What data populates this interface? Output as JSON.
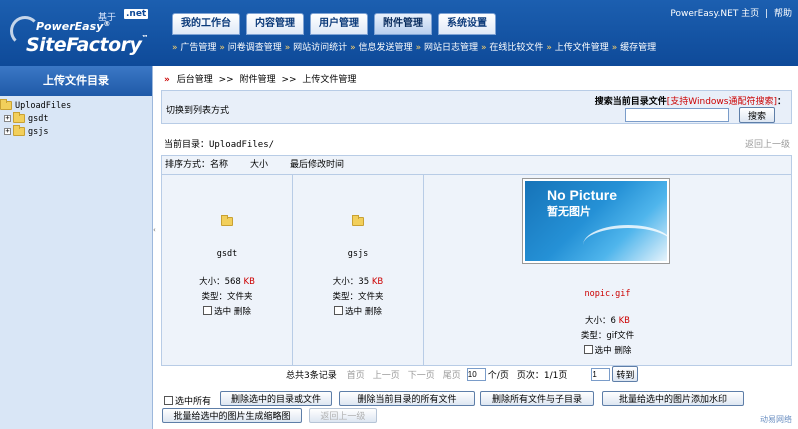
{
  "header": {
    "logo": {
      "based_on": "基于",
      "net": ".net",
      "line1": "PowerEasy",
      "line1_mark": "®",
      "line2": "SiteFactory",
      "line2_mark": "™"
    },
    "tabs": [
      {
        "label": "我的工作台",
        "active": false
      },
      {
        "label": "内容管理",
        "active": false
      },
      {
        "label": "用户管理",
        "active": false
      },
      {
        "label": "附件管理",
        "active": true
      },
      {
        "label": "系统设置",
        "active": false
      }
    ],
    "top_links": {
      "home": "PowerEasy.NET 主页",
      "sep": "|",
      "help": "帮助"
    },
    "subnav": [
      "广告管理",
      "问卷调查管理",
      "网站访问统计",
      "信息发送管理",
      "网站日志管理",
      "在线比较文件",
      "上传文件管理",
      "缓存管理"
    ]
  },
  "sidebar": {
    "title": "上传文件目录",
    "root": "UploadFiles",
    "children": [
      {
        "expander": "+",
        "label": "gsdt"
      },
      {
        "expander": "+",
        "label": "gsjs"
      }
    ],
    "collapse_glyph": "‹"
  },
  "main": {
    "breadcrumb": {
      "marker": "»",
      "items": [
        "后台管理",
        "附件管理",
        "上传文件管理"
      ],
      "sep": ">>"
    },
    "search": {
      "switch_view": "切换到列表方式",
      "label": "搜索当前目录文件",
      "hint": "[支持Windows通配符搜索]",
      "colon": "：",
      "value": "",
      "button": "搜索"
    },
    "current_dir": {
      "label": "当前目录：",
      "path": "UploadFiles/",
      "up": "返回上一级"
    },
    "sort": {
      "label": "排序方式：",
      "options": [
        "名称",
        "大小",
        "最后修改时间"
      ]
    },
    "files": [
      {
        "name": "gsdt",
        "size_label": "大小：",
        "size": "568",
        "unit": "KB",
        "type_label": "类型：",
        "type": "文件夹",
        "select": "选中",
        "delete": "删除"
      },
      {
        "name": "gsjs",
        "size_label": "大小：",
        "size": "35",
        "unit": "KB",
        "type_label": "类型：",
        "type": "文件夹",
        "select": "选中",
        "delete": "删除"
      },
      {
        "name": "nopic.gif",
        "preview_t1": "No Picture",
        "preview_t2": "暂无图片",
        "size_label": "大小：",
        "size": "6",
        "unit": "KB",
        "type_label": "类型：",
        "type": "gif文件",
        "select": "选中",
        "delete": "删除"
      }
    ],
    "pager": {
      "total": "总共3条记录",
      "first": "首页",
      "prev": "上一页",
      "next": "下一页",
      "last": "尾页",
      "per_page_value": "10",
      "per_page_unit": "个/页",
      "page_label": "页次：",
      "page": "1/1页",
      "goto_value": "1",
      "goto_button": "转到"
    },
    "actions": {
      "select_all": "选中所有",
      "delete_selected": "删除选中的目录或文件",
      "delete_all_current": "删除当前目录的所有文件",
      "delete_all_sub": "删除所有文件与子目录",
      "watermark": "批量给选中的图片添加水印",
      "thumbs": "批量给选中的图片生成缩略图",
      "back": "返回上一级"
    },
    "corner_mark": "动易网络"
  }
}
